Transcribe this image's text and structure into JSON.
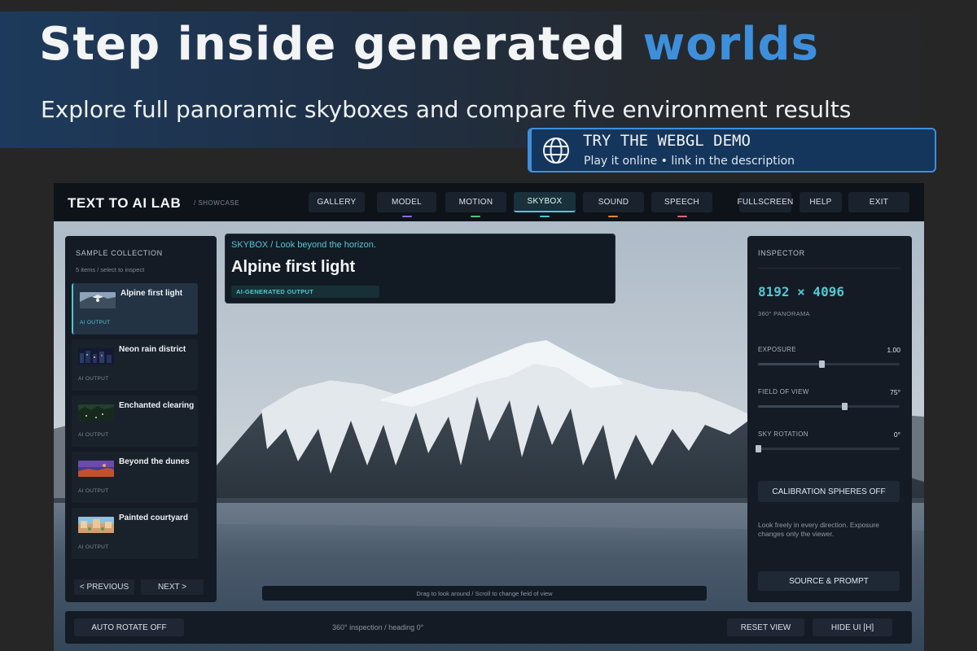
{
  "promo": {
    "title_main": "Step inside generated ",
    "title_accent": "worlds",
    "subtitle": "Explore full panoramic skyboxes and compare five environment results",
    "callout_title": "TRY THE WEBGL DEMO",
    "callout_sub": "Play it online  •  link in the description",
    "accent_color": "#3d8fdc"
  },
  "app": {
    "title": "TEXT TO AI LAB",
    "crumb": "/  SHOWCASE",
    "nav": {
      "gallery": "GALLERY",
      "model": "MODEL",
      "motion": "MOTION",
      "skybox": "SKYBOX",
      "sound": "SOUND",
      "speech": "SPEECH",
      "fullscreen": "FULLSCREEN",
      "help": "HELP",
      "exit": "EXIT"
    },
    "nav_dot_colors": {
      "model": "#8a6cd8",
      "motion": "#5bc27a",
      "skybox": "#4fc9d4",
      "sound": "#e08a3c",
      "speech": "#d9667d"
    },
    "active_tab": "SKYBOX"
  },
  "collection": {
    "title": "SAMPLE COLLECTION",
    "count": "5 items  /  select to inspect",
    "items": [
      {
        "name": "Alpine first light",
        "tag": "AI OUTPUT"
      },
      {
        "name": "Neon rain district",
        "tag": "AI OUTPUT"
      },
      {
        "name": "Enchanted clearing",
        "tag": "AI OUTPUT"
      },
      {
        "name": "Beyond the dunes",
        "tag": "AI OUTPUT"
      },
      {
        "name": "Painted courtyard",
        "tag": "AI OUTPUT"
      }
    ],
    "prev": "<  PREVIOUS",
    "next": "NEXT  >"
  },
  "title_card": {
    "crumb": "SKYBOX  /  Look beyond the horizon.",
    "title": "Alpine first light",
    "badge": "AI-GENERATED OUTPUT"
  },
  "inspector": {
    "title": "INSPECTOR",
    "resolution": "8192 × 4096",
    "resolution_sub": "360° PANORAMA",
    "exposure_label": "EXPOSURE",
    "exposure_value": "1.00",
    "exposure_level": 0.45,
    "fov_label": "FIELD OF VIEW",
    "fov_value": "75°",
    "fov_level": 0.61,
    "rotation_label": "SKY ROTATION",
    "rotation_value": "0°",
    "rotation_level": 0.0,
    "calibration": "CALIBRATION SPHERES  OFF",
    "note": "Look freely in every direction. Exposure changes only the viewer.",
    "source_prompt": "SOURCE & PROMPT"
  },
  "hint": "Drag to look around  /  Scroll to change field of view",
  "bottom": {
    "auto_rotate": "AUTO ROTATE   OFF",
    "status": "360° inspection  /  heading 0°",
    "reset_view": "RESET VIEW",
    "hide_ui": "HIDE UI  [H]"
  }
}
